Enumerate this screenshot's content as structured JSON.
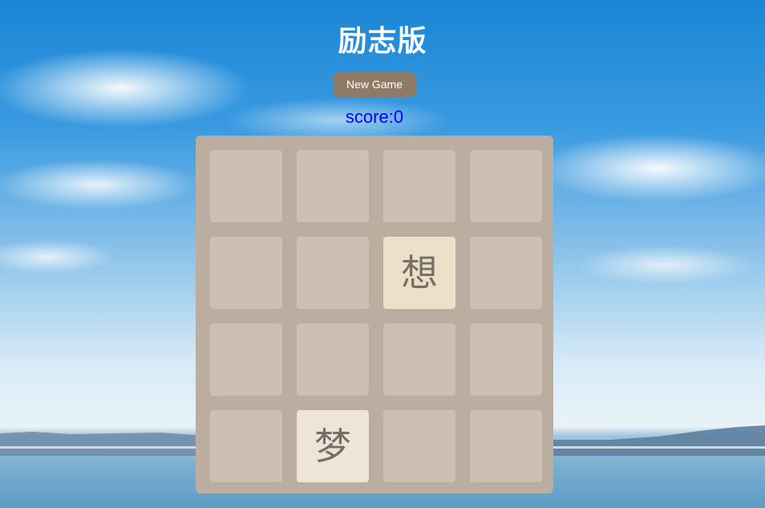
{
  "header": {
    "title": "励志版",
    "new_game_label": "New Game",
    "score_text": "score:0"
  },
  "score": 0,
  "board": {
    "rows": 4,
    "cols": 4,
    "tiles": [
      {
        "row": 1,
        "col": 2,
        "text": "想",
        "color": "#ede0c8"
      },
      {
        "row": 3,
        "col": 1,
        "text": "梦",
        "color": "#eee4da"
      }
    ]
  },
  "colors": {
    "board": "#bbada0",
    "cell": "#ccc0b3",
    "button": "#8f7a66",
    "score": "#0000ff",
    "tile_text": "#776e65"
  }
}
